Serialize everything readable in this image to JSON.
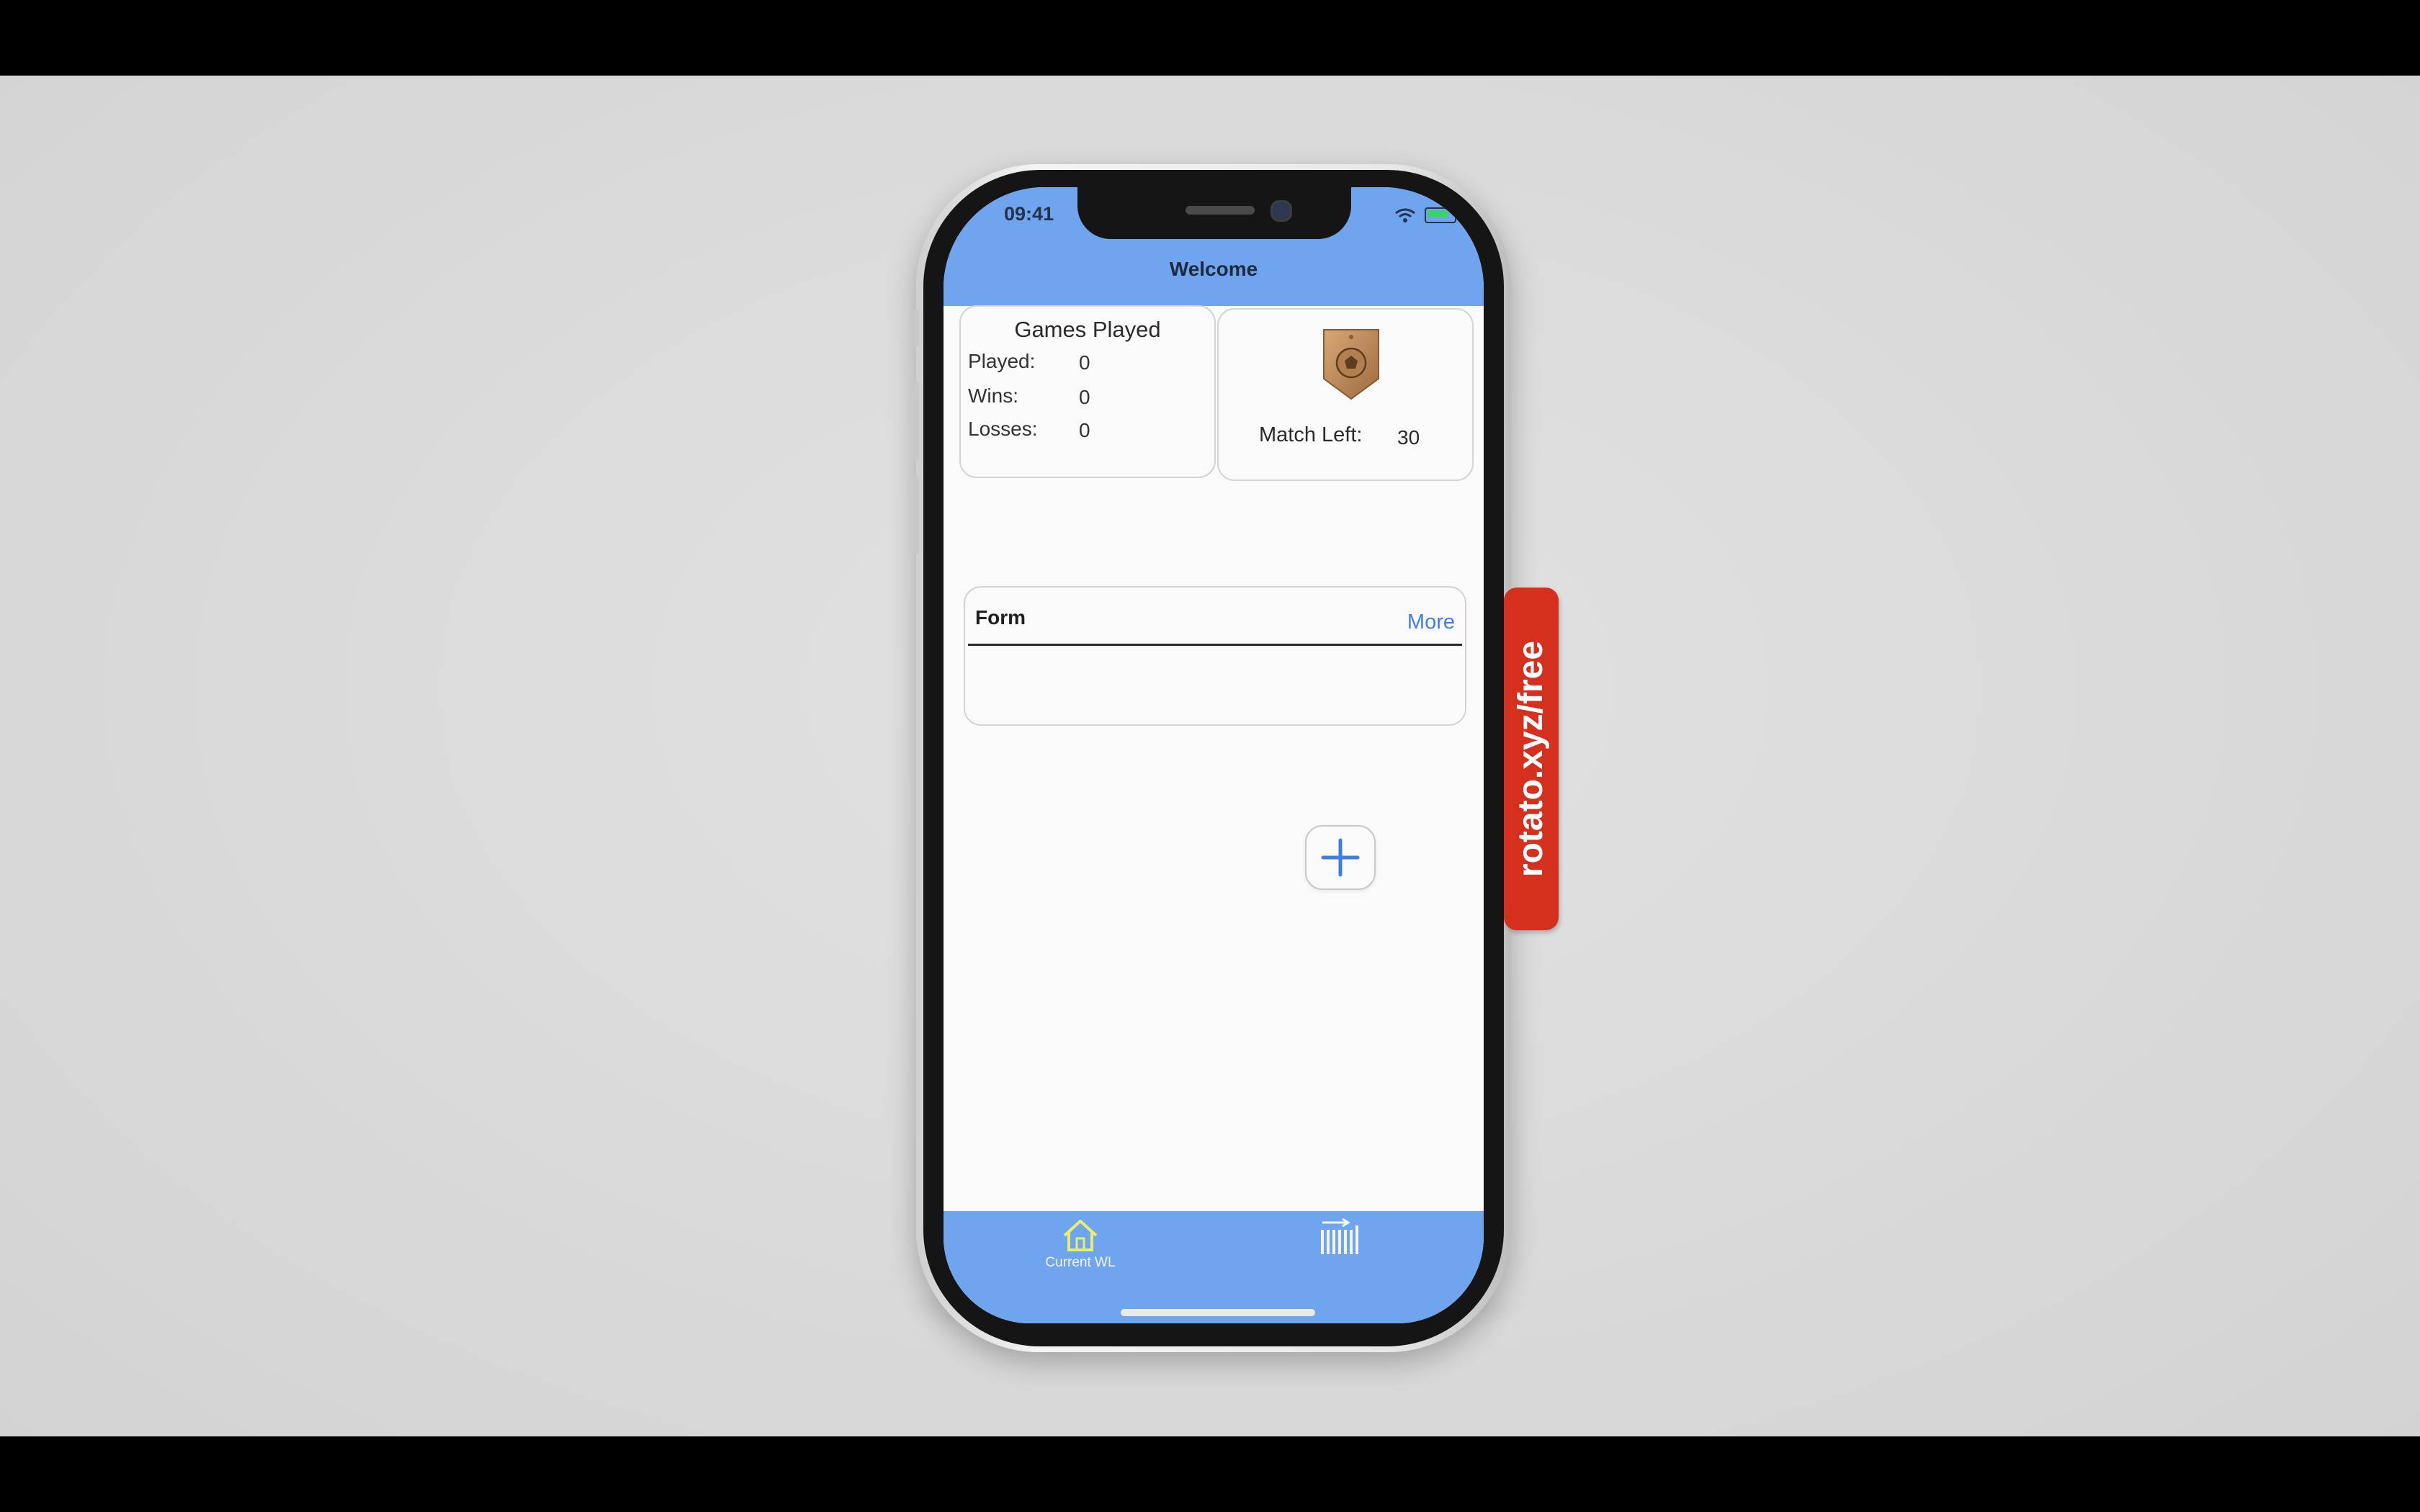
{
  "status_bar": {
    "time": "09:41"
  },
  "nav": {
    "title": "Welcome"
  },
  "games_card": {
    "title": "Games Played",
    "rows": [
      {
        "label": "Played:",
        "value": "0"
      },
      {
        "label": "Wins:",
        "value": "0"
      },
      {
        "label": "Losses:",
        "value": "0"
      }
    ]
  },
  "match_card": {
    "badge_icon": "soccer-badge-icon",
    "label": "Match Left:",
    "value": "30"
  },
  "form_card": {
    "title": "Form",
    "more_label": "More"
  },
  "add_button": {
    "icon": "plus-icon"
  },
  "tabbar": {
    "home_label": "Current WL",
    "home_icon": "home-icon",
    "list_icon": "list-export-icon"
  },
  "colors": {
    "nav_blue": "#6ea5ee",
    "accent_blue": "#3f7fe0",
    "active_tab": "#e8ef6a",
    "watermark_red": "#d4301d"
  },
  "watermark": {
    "text": "rotato.xyz/free"
  }
}
